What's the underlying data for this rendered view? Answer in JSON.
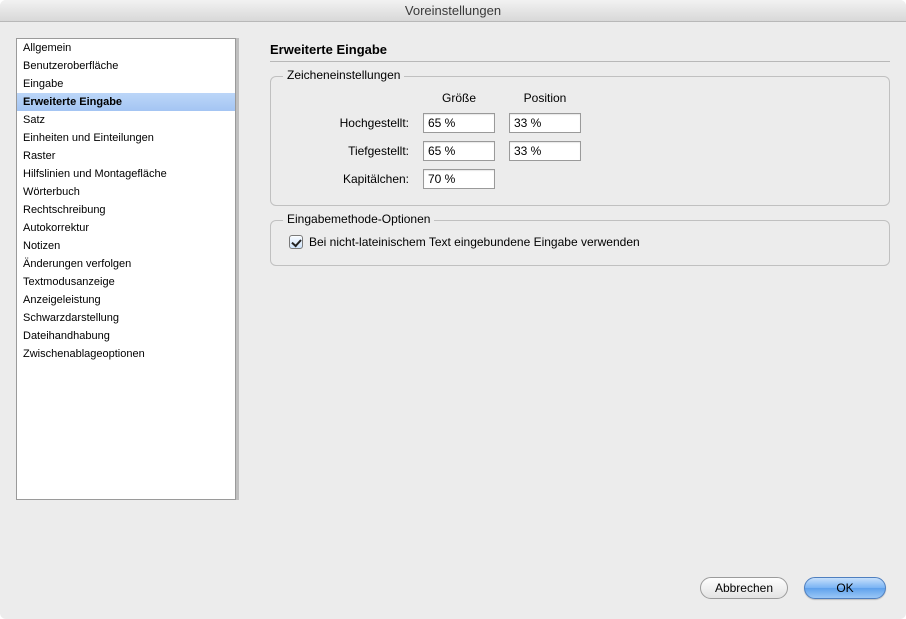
{
  "window": {
    "title": "Voreinstellungen"
  },
  "sidebar": {
    "items": [
      {
        "label": "Allgemein",
        "selected": false
      },
      {
        "label": "Benutzeroberfläche",
        "selected": false
      },
      {
        "label": "Eingabe",
        "selected": false
      },
      {
        "label": "Erweiterte Eingabe",
        "selected": true
      },
      {
        "label": "Satz",
        "selected": false
      },
      {
        "label": "Einheiten und Einteilungen",
        "selected": false
      },
      {
        "label": "Raster",
        "selected": false
      },
      {
        "label": "Hilfslinien und Montagefläche",
        "selected": false
      },
      {
        "label": "Wörterbuch",
        "selected": false
      },
      {
        "label": "Rechtschreibung",
        "selected": false
      },
      {
        "label": "Autokorrektur",
        "selected": false
      },
      {
        "label": "Notizen",
        "selected": false
      },
      {
        "label": "Änderungen verfolgen",
        "selected": false
      },
      {
        "label": "Textmodusanzeige",
        "selected": false
      },
      {
        "label": "Anzeigeleistung",
        "selected": false
      },
      {
        "label": "Schwarzdarstellung",
        "selected": false
      },
      {
        "label": "Dateihandhabung",
        "selected": false
      },
      {
        "label": "Zwischenablageoptionen",
        "selected": false
      }
    ]
  },
  "panel": {
    "heading": "Erweiterte Eingabe",
    "charSettings": {
      "legend": "Zeicheneinstellungen",
      "colSize": "Größe",
      "colPosition": "Position",
      "rows": {
        "superscript": {
          "label": "Hochgestellt:",
          "size": "65 %",
          "position": "33 %"
        },
        "subscript": {
          "label": "Tiefgestellt:",
          "size": "65 %",
          "position": "33 %"
        },
        "smallcaps": {
          "label": "Kapitälchen:",
          "size": "70 %"
        }
      }
    },
    "imeOptions": {
      "legend": "Eingabemethode-Optionen",
      "useInline": {
        "label": "Bei nicht-lateinischem Text eingebundene Eingabe verwenden",
        "checked": true
      }
    }
  },
  "buttons": {
    "cancel": "Abbrechen",
    "ok": "OK"
  }
}
